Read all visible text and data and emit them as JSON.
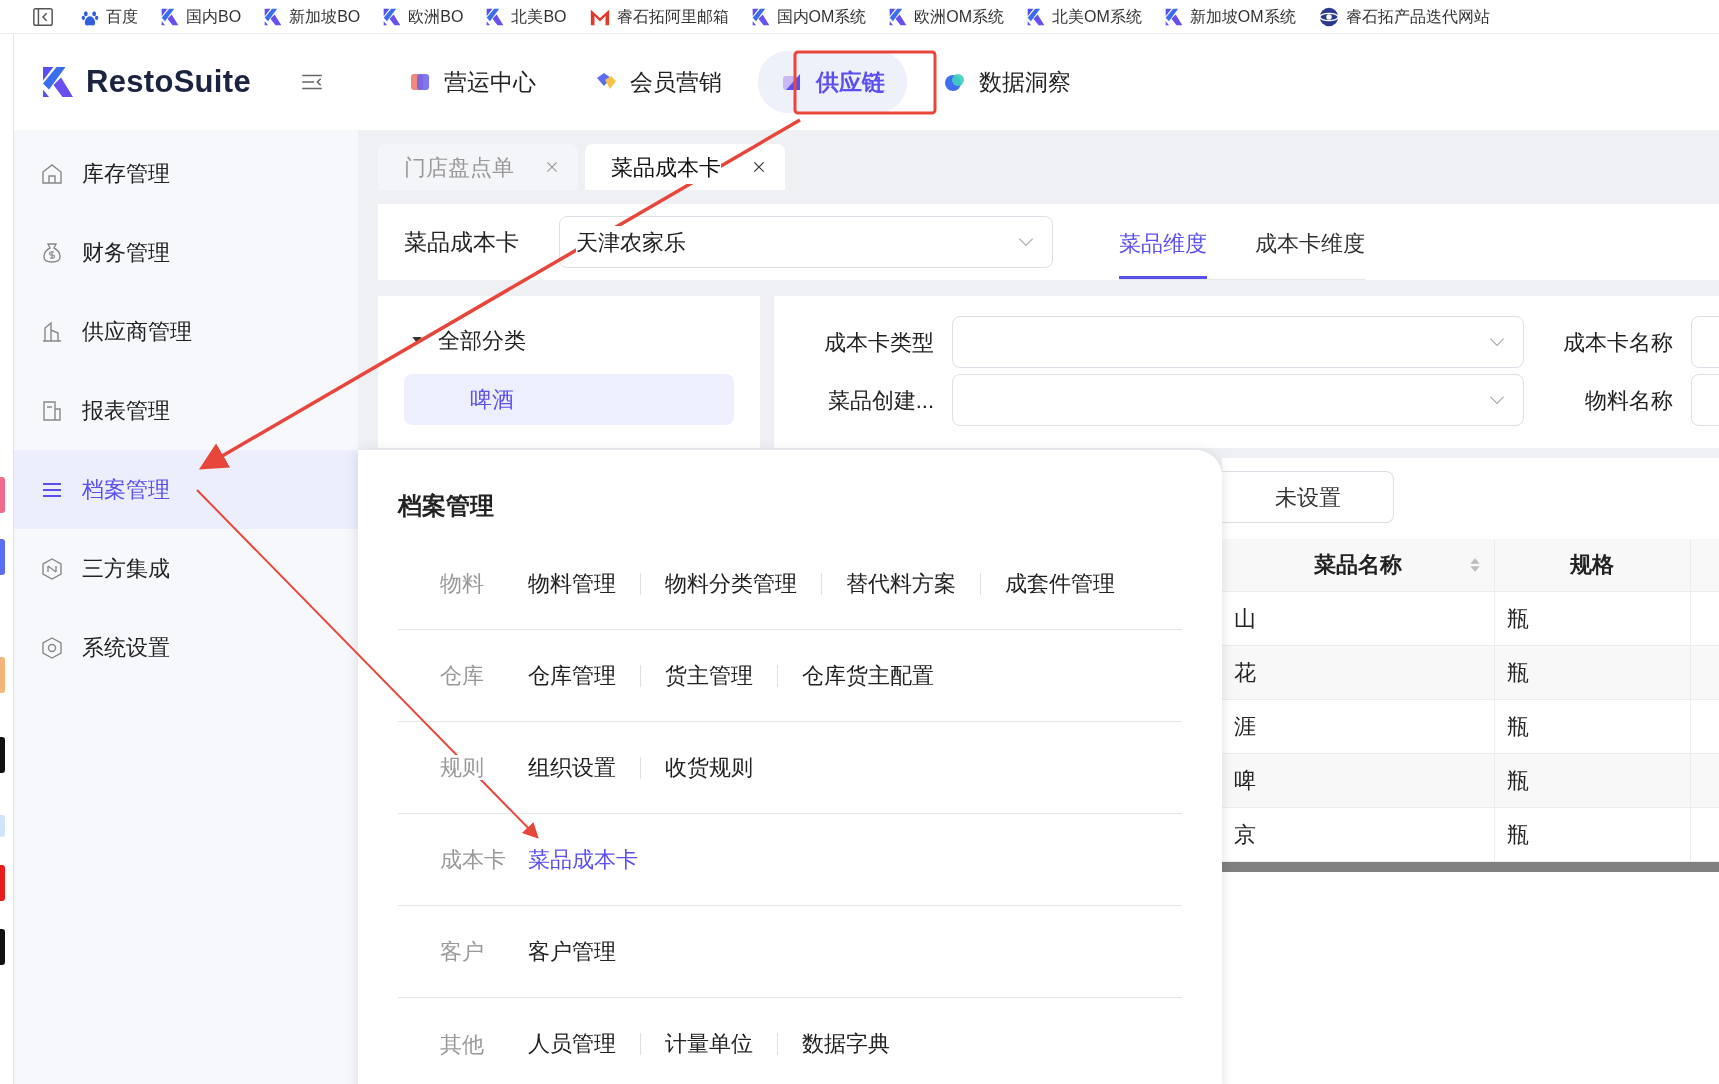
{
  "bookmarks": [
    {
      "kind": "resto-back"
    },
    {
      "kind": "baidu",
      "label": "百度"
    },
    {
      "kind": "resto",
      "label": "国内BO"
    },
    {
      "kind": "resto",
      "label": "新加坡BO"
    },
    {
      "kind": "resto",
      "label": "欧洲BO"
    },
    {
      "kind": "resto",
      "label": "北美BO"
    },
    {
      "kind": "mail",
      "label": "睿石拓阿里邮箱"
    },
    {
      "kind": "resto",
      "label": "国内OM系统"
    },
    {
      "kind": "resto",
      "label": "欧洲OM系统"
    },
    {
      "kind": "resto",
      "label": "北美OM系统"
    },
    {
      "kind": "resto",
      "label": "新加坡OM系统"
    },
    {
      "kind": "globe",
      "label": "睿石拓产品迭代网站"
    }
  ],
  "brand": "RestoSuite",
  "top_nav": [
    {
      "label": "营运中心",
      "kind": "ops",
      "selected": false
    },
    {
      "label": "会员营销",
      "kind": "member",
      "selected": false
    },
    {
      "label": "供应链",
      "kind": "supply",
      "selected": true
    },
    {
      "label": "数据洞察",
      "kind": "data",
      "selected": false
    }
  ],
  "sidebar": {
    "items": [
      {
        "label": "库存管理",
        "kind": "home",
        "selected": false
      },
      {
        "label": "财务管理",
        "kind": "money",
        "selected": false
      },
      {
        "label": "供应商管理",
        "kind": "building",
        "selected": false
      },
      {
        "label": "报表管理",
        "kind": "report",
        "selected": false
      },
      {
        "label": "档案管理",
        "kind": "list",
        "selected": true
      },
      {
        "label": "三方集成",
        "kind": "link",
        "selected": false
      },
      {
        "label": "系统设置",
        "kind": "gear",
        "selected": false
      }
    ]
  },
  "page_tabs": [
    {
      "label": "门店盘点单",
      "selected": false
    },
    {
      "label": "菜品成本卡",
      "selected": true
    }
  ],
  "filter": {
    "title": "菜品成本卡",
    "store": "天津农家乐",
    "views": [
      {
        "label": "菜品维度",
        "selected": true
      },
      {
        "label": "成本卡维度",
        "selected": false
      }
    ]
  },
  "tree": {
    "label": "全部分类",
    "expanded": true,
    "children": [
      {
        "label": "啤酒",
        "selected": true
      }
    ]
  },
  "form": {
    "fields": [
      {
        "label": "成本卡类型",
        "kind": "select"
      },
      {
        "label": "成本卡名称",
        "kind": "input"
      },
      {
        "label": "菜品创建...",
        "kind": "select"
      },
      {
        "label": "物料名称",
        "kind": "input"
      }
    ]
  },
  "status_button": "未设置",
  "table": {
    "columns": [
      {
        "label": "菜品名称",
        "sortable": true
      },
      {
        "label": "规格",
        "sortable": false
      }
    ],
    "rows": [
      [
        "山",
        "瓶"
      ],
      [
        "花",
        "瓶"
      ],
      [
        "涯",
        "瓶"
      ],
      [
        "啤",
        "瓶"
      ],
      [
        "京",
        "瓶"
      ]
    ]
  },
  "popup": {
    "title": "档案管理",
    "groups": [
      {
        "category": "物料",
        "items": [
          {
            "label": "物料管理",
            "selected": false
          },
          {
            "label": "物料分类管理",
            "selected": false
          },
          {
            "label": "替代料方案",
            "selected": false
          },
          {
            "label": "成套件管理",
            "selected": false
          }
        ]
      },
      {
        "category": "仓库",
        "items": [
          {
            "label": "仓库管理",
            "selected": false
          },
          {
            "label": "货主管理",
            "selected": false
          },
          {
            "label": "仓库货主配置",
            "selected": false
          }
        ]
      },
      {
        "category": "规则",
        "items": [
          {
            "label": "组织设置",
            "selected": false
          },
          {
            "label": "收货规则",
            "selected": false
          }
        ]
      },
      {
        "category": "成本卡",
        "items": [
          {
            "label": "菜品成本卡",
            "selected": true
          }
        ]
      },
      {
        "category": "客户",
        "items": [
          {
            "label": "客户管理",
            "selected": false
          }
        ]
      },
      {
        "category": "其他",
        "items": [
          {
            "label": "人员管理",
            "selected": false
          },
          {
            "label": "计量单位",
            "selected": false
          },
          {
            "label": "数据字典",
            "selected": false
          }
        ]
      }
    ]
  },
  "annotations": [
    {
      "kind": "frame"
    },
    {
      "kind": "arrow"
    },
    {
      "kind": "arrow"
    }
  ]
}
